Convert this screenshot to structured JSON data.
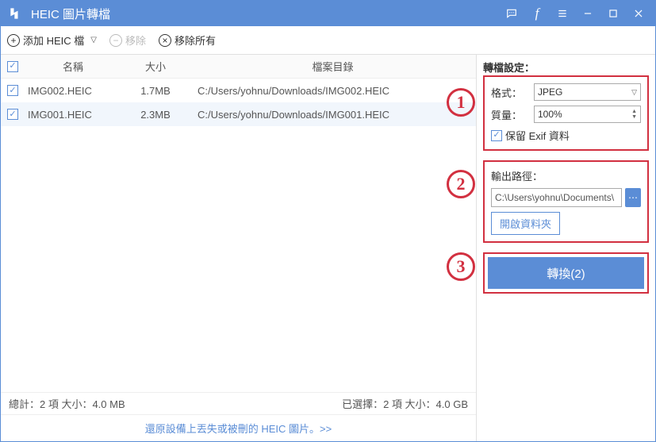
{
  "title": "HEIC 圖片轉檔",
  "toolbar": {
    "add": "添加 HEIC 檔",
    "remove": "移除",
    "removeAll": "移除所有"
  },
  "columns": {
    "name": "名稱",
    "size": "大小",
    "path": "檔案目錄"
  },
  "rows": [
    {
      "checked": true,
      "name": "IMG002.HEIC",
      "size": "1.7MB",
      "path": "C:/Users/yohnu/Downloads/IMG002.HEIC"
    },
    {
      "checked": true,
      "name": "IMG001.HEIC",
      "size": "2.3MB",
      "path": "C:/Users/yohnu/Downloads/IMG001.HEIC"
    }
  ],
  "status": {
    "total": "總計：2 項 大小：4.0 MB",
    "selected": "已選擇：2 項 大小：4.0 GB"
  },
  "restore": "還原設備上丟失或被刪的 HEIC 圖片。>>",
  "settings": {
    "title": "轉檔設定：",
    "formatLabel": "格式：",
    "formatValue": "JPEG",
    "qualityLabel": "質量：",
    "qualityValue": "100%",
    "exifLabel": "保留 Exif 資料",
    "outputTitle": "輸出路徑：",
    "outputPath": "C:\\Users\\yohnu\\Documents\\",
    "openFolder": "開啟資料夾",
    "convert": "轉換(2)"
  },
  "steps": [
    "1",
    "2",
    "3"
  ]
}
